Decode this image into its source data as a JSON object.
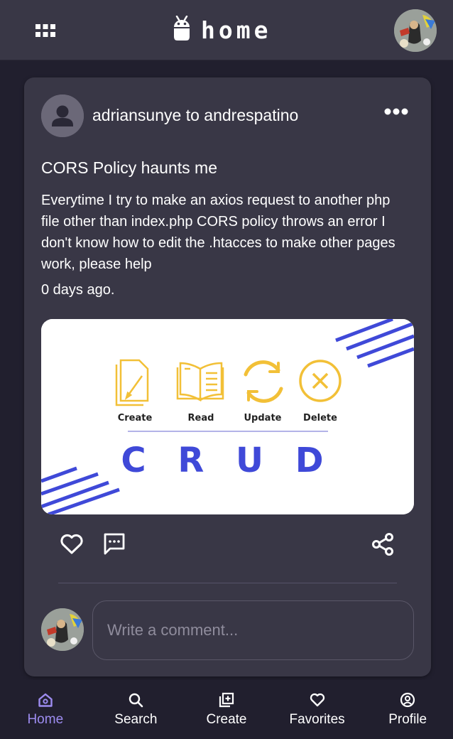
{
  "header": {
    "title": "home",
    "menu_icon": "grid-icon",
    "brand_icon": "android-icon",
    "avatar_alt": "user avatar"
  },
  "post": {
    "author": "adriansunye",
    "connector": "to",
    "recipient": "andrespatino",
    "title": "CORS Policy haunts me",
    "body": "Everytime I try to make an axios request to another php file other than index.php CORS policy throws an error I don't know how to edit the .htacces to make other pages work, please help",
    "time": "0 days ago.",
    "image": {
      "labels": [
        "Create",
        "Read",
        "Update",
        "Delete"
      ],
      "title": "C R U D"
    }
  },
  "comment": {
    "placeholder": "Write a comment..."
  },
  "nav": {
    "items": [
      {
        "label": "Home",
        "icon": "home-icon",
        "active": true
      },
      {
        "label": "Search",
        "icon": "search-icon"
      },
      {
        "label": "Create",
        "icon": "add-square-icon"
      },
      {
        "label": "Favorites",
        "icon": "heart-icon"
      },
      {
        "label": "Profile",
        "icon": "profile-icon"
      }
    ]
  },
  "colors": {
    "background": "#211f2e",
    "card": "#393746",
    "accent": "#9d8cf0",
    "crud_yellow": "#f2c037",
    "crud_blue": "#3f49d8"
  }
}
